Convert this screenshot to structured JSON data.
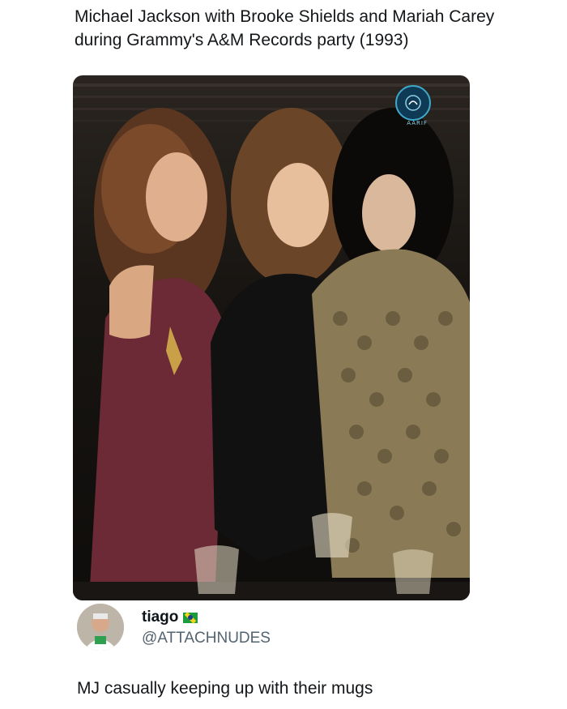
{
  "post": {
    "caption": "Michael Jackson with Brooke Shields and Mariah Carey during Grammy's A&M Records party (1993)",
    "watermark_text": "AARIF"
  },
  "author": {
    "display_name": "tiago",
    "handle": "@ATTACHNUDES",
    "badge_icon": "brazil-flag-icon"
  },
  "tweet": {
    "text": "MJ casually keeping up with their mugs"
  },
  "colors": {
    "text": "#14171a",
    "secondary_text": "#536471",
    "background": "#ffffff"
  }
}
